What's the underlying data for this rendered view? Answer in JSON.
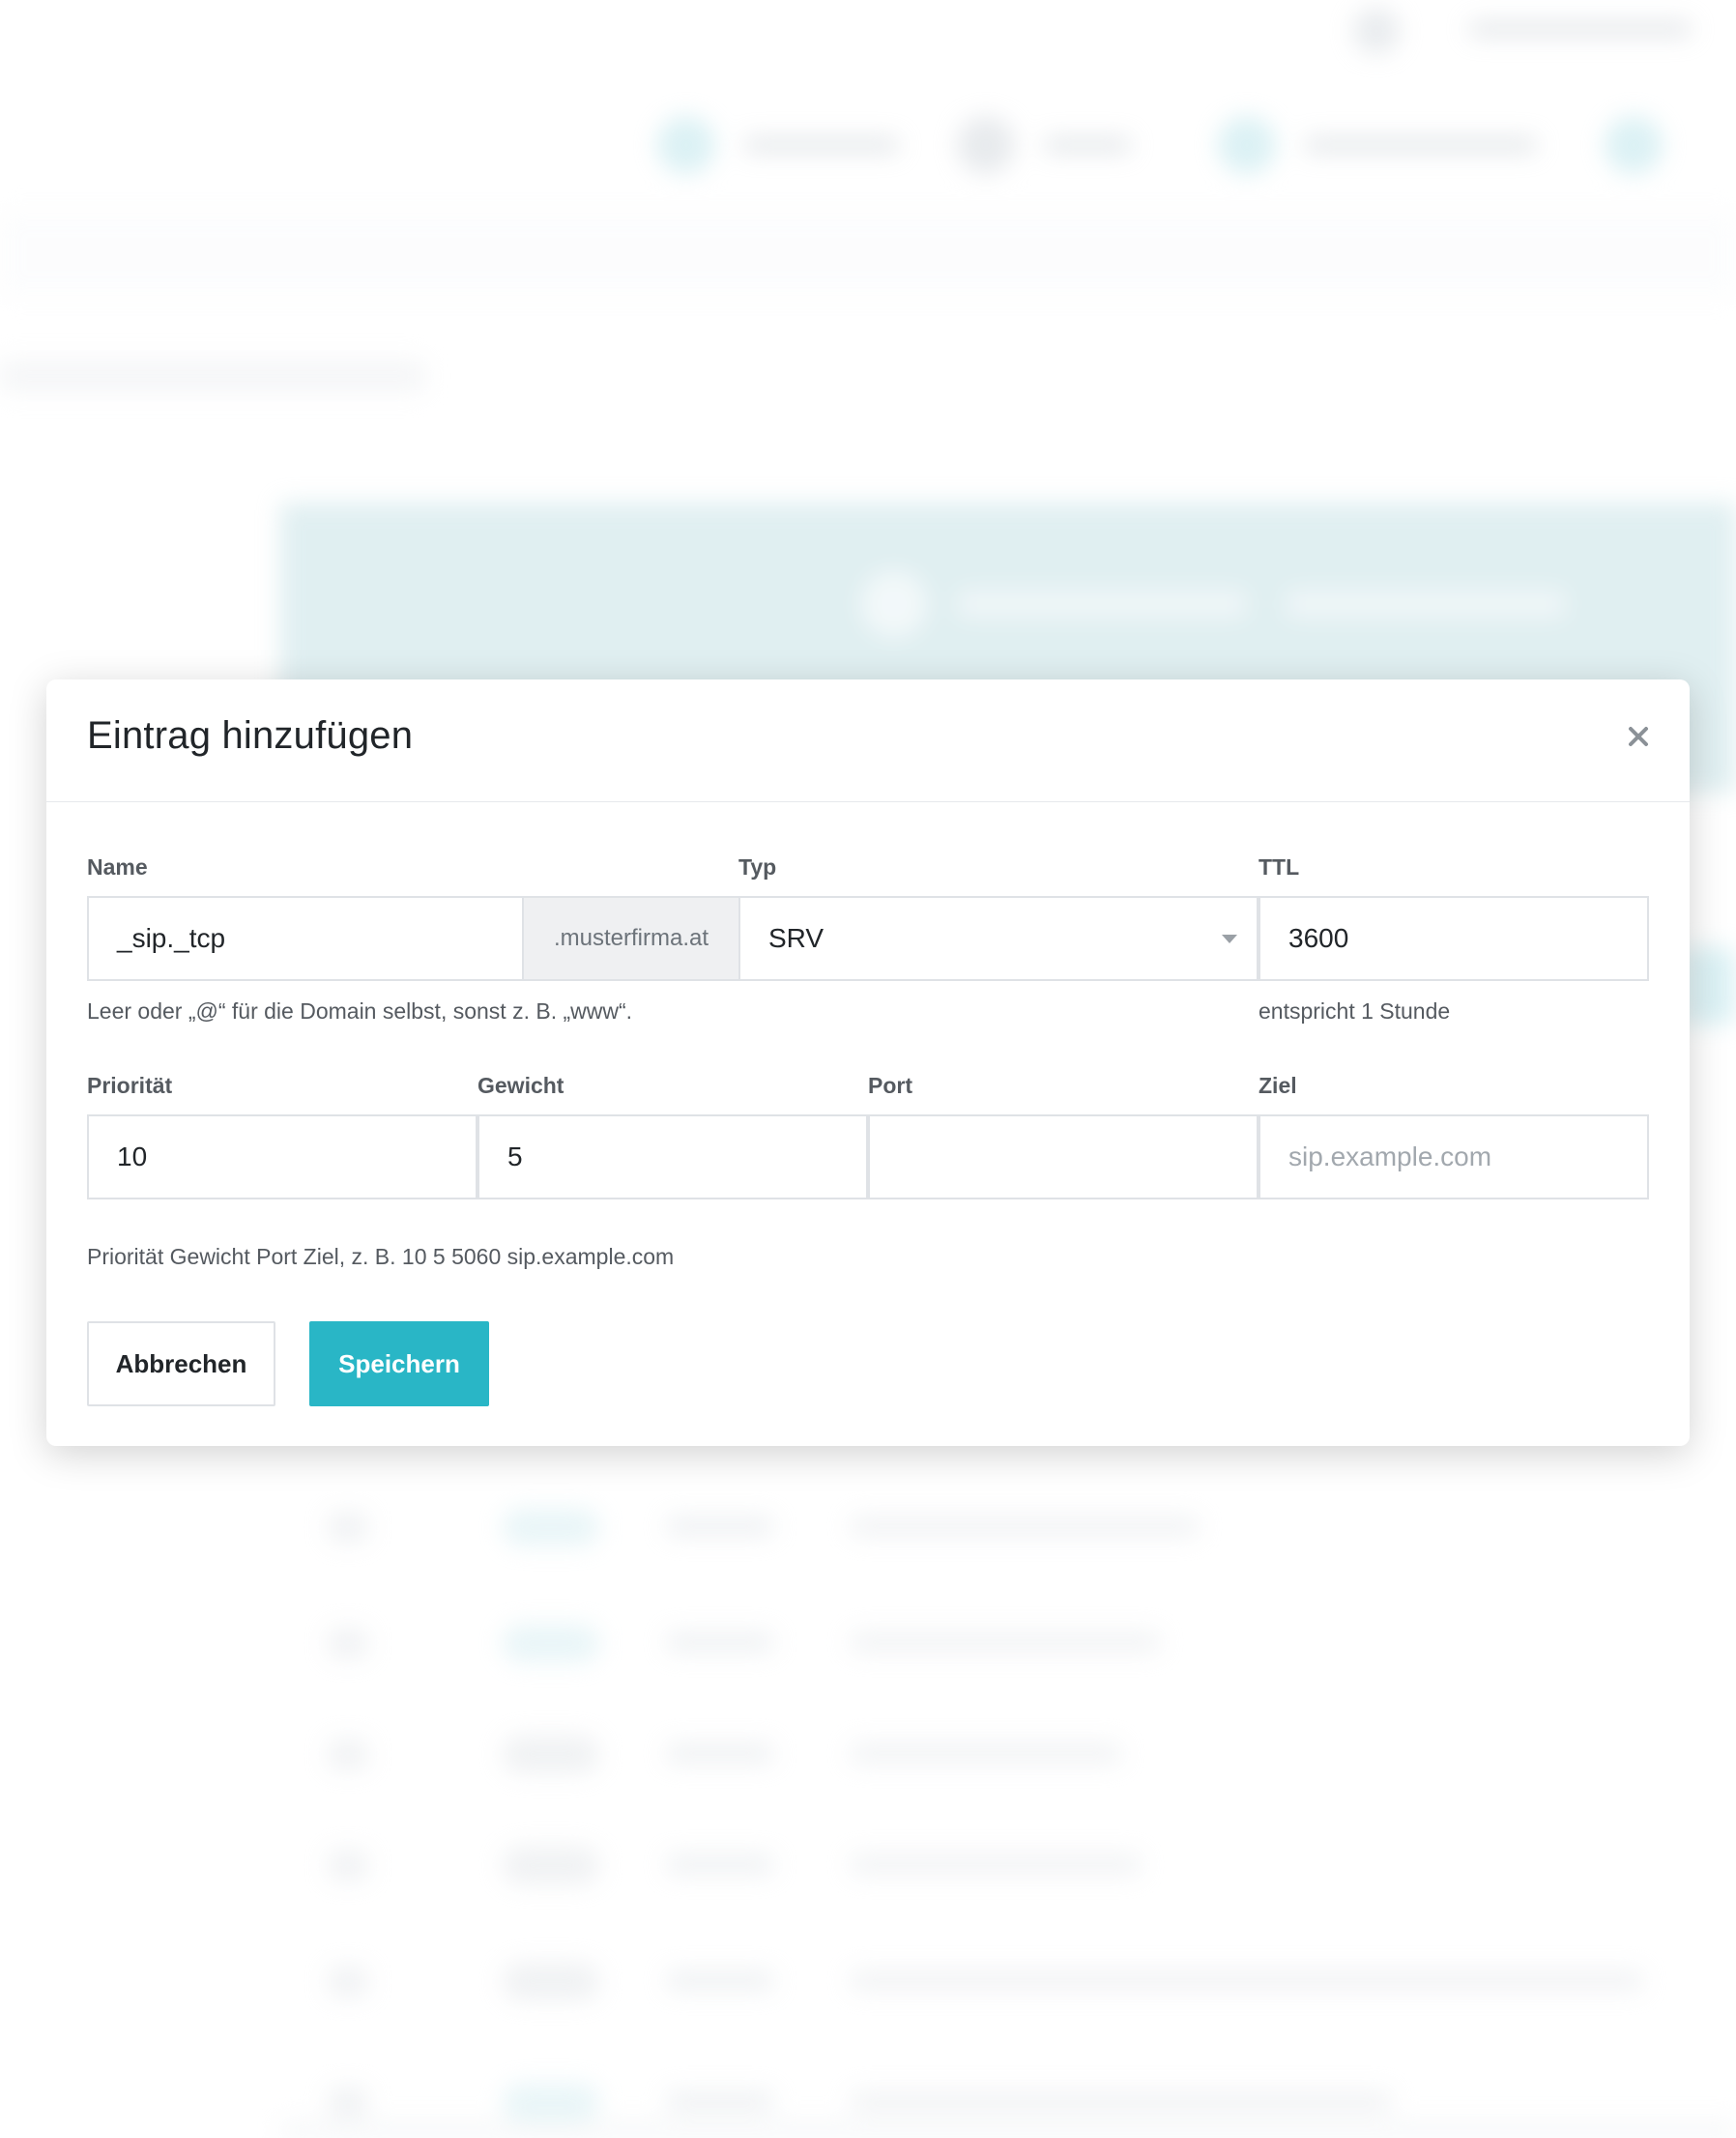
{
  "modal": {
    "title": "Eintrag hinzufügen",
    "close_icon": "close-icon"
  },
  "form": {
    "name": {
      "label": "Name",
      "value": "_sip._tcp",
      "suffix": ".musterfirma.at",
      "help": "Leer oder „@“ für die Domain selbst, sonst z. B. „www“."
    },
    "type": {
      "label": "Typ",
      "value": "SRV",
      "caret_icon": "caret-down-icon"
    },
    "ttl": {
      "label": "TTL",
      "value": "3600",
      "help": "entspricht 1 Stunde"
    },
    "priority": {
      "label": "Priorität",
      "value": "10"
    },
    "weight": {
      "label": "Gewicht",
      "value": "5"
    },
    "port": {
      "label": "Port",
      "value": ""
    },
    "target": {
      "label": "Ziel",
      "value": "",
      "placeholder": "sip.example.com"
    },
    "srv_help": "Priorität Gewicht Port Ziel, z. B. 10 5 5060 sip.example.com"
  },
  "actions": {
    "cancel_label": "Abbrechen",
    "save_label": "Speichern"
  },
  "colors": {
    "primary": "#29b6c6",
    "banner_background": "#c7e2e6"
  }
}
